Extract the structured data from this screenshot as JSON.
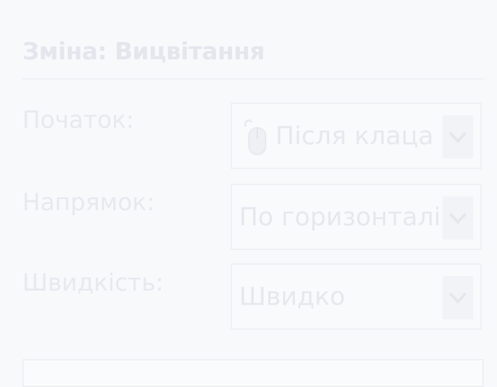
{
  "header": {
    "title": "Зміна: Вицвітання"
  },
  "rows": [
    {
      "label": "Початок:",
      "value": "Після клаца",
      "icon": "mouse-icon"
    },
    {
      "label": "Напрямок:",
      "value": "По горизонталі"
    },
    {
      "label": "Швидкість:",
      "value": "Швидко"
    }
  ],
  "colors": {
    "background": "#f8f9fb",
    "text": "#e5e8ed"
  }
}
